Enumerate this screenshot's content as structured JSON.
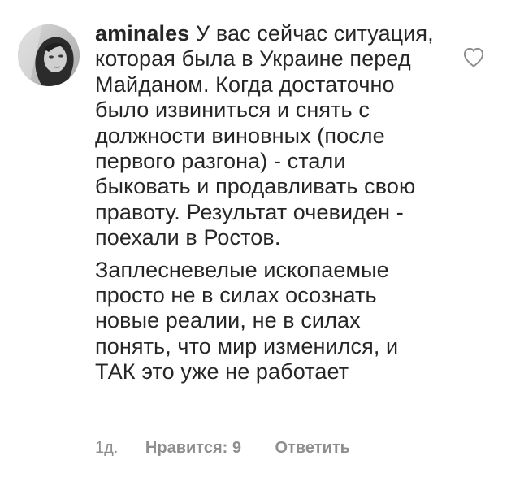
{
  "comment": {
    "avatar_icon": "user-avatar-photo",
    "username": "aminales",
    "paragraph_1": "У вас сейчас ситуация, которая была в Украине перед Майданом. Когда достаточно было извиниться и снять с должности виновных (после первого разгона) - стали быковать и продавливать свою правоту. Результат очевиден - поехали в Ростов.",
    "paragraph_2": "Заплесневелые ископаемые просто не в силах осознать новые реалии, не в силах понять, что мир изменился, и ТАК это уже не работает",
    "like_icon": "heart-outline-icon"
  },
  "meta": {
    "time": "1д.",
    "likes": "Нравится: 9",
    "reply": "Ответить"
  },
  "colors": {
    "text": "#262626",
    "secondary": "#8e8e8e",
    "background": "#ffffff"
  }
}
